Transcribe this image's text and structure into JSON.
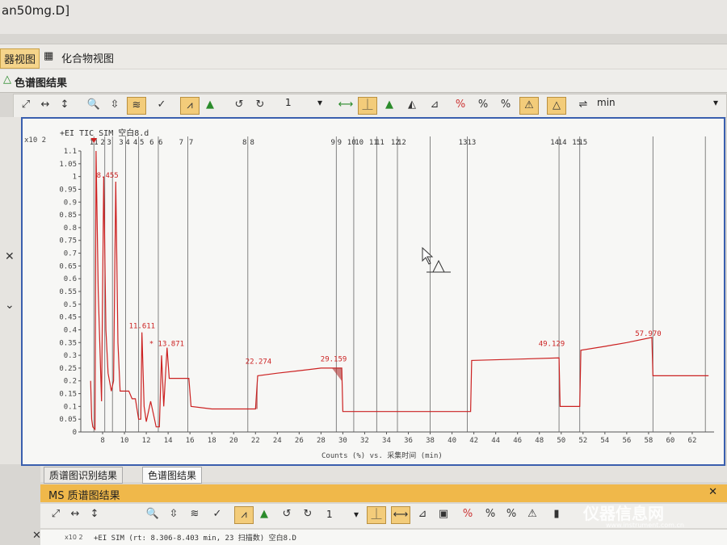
{
  "window": {
    "title": "an50mg.D]"
  },
  "view_tabs": {
    "spectrum_view": "器视图",
    "compound_view": "化合物视图"
  },
  "panel": {
    "title": "色谱图结果"
  },
  "toolbar": {
    "combo_value": "1",
    "unit_combo": "min"
  },
  "chart_data": {
    "type": "line",
    "title": "+EI TIC SIM 空白8.d",
    "y_multiplier": "x10 2",
    "xlabel": "Counts (%) vs. 采集时间 (min)",
    "xlim": [
      6,
      64
    ],
    "ylim": [
      0,
      1.1
    ],
    "xticks": [
      "8",
      "10",
      "12",
      "14",
      "16",
      "18",
      "20",
      "22",
      "24",
      "26",
      "28",
      "30",
      "32",
      "34",
      "36",
      "38",
      "40",
      "42",
      "44",
      "46",
      "48",
      "50",
      "52",
      "54",
      "56",
      "58",
      "60",
      "62"
    ],
    "yticks": [
      "0",
      "0.05",
      "0.1",
      "0.15",
      "0.2",
      "0.25",
      "0.3",
      "0.35",
      "0.4",
      "0.45",
      "0.5",
      "0.55",
      "0.6",
      "0.65",
      "0.7",
      "0.75",
      "0.8",
      "0.85",
      "0.9",
      "0.95",
      "1",
      "1.05",
      "1.1"
    ],
    "segment_labels": [
      "1",
      "1",
      "2",
      "3",
      "3",
      "4",
      "4",
      "5",
      "6",
      "6",
      "7",
      "7",
      "8",
      "8",
      "9",
      "9",
      "10",
      "10",
      "11",
      "11",
      "12",
      "12",
      "13",
      "13",
      "14",
      "14",
      "15",
      "15"
    ],
    "segment_bounds": [
      7.2,
      8.2,
      8.9,
      10.1,
      11.3,
      13.1,
      15.8,
      21.3,
      29.4,
      31.0,
      33.1,
      35.0,
      38.0,
      41.4,
      49.8,
      51.7,
      58.4,
      63.2
    ],
    "peak_labels": [
      {
        "x": 8.455,
        "y": 0.99,
        "text": "8.455"
      },
      {
        "x": 11.611,
        "y": 0.4,
        "text": "11.611"
      },
      {
        "x": 13.871,
        "y": 0.33,
        "text": "* 13.871"
      },
      {
        "x": 22.274,
        "y": 0.26,
        "text": "22.274"
      },
      {
        "x": 29.159,
        "y": 0.27,
        "text": "29.159"
      },
      {
        "x": 49.129,
        "y": 0.33,
        "text": "49.129"
      },
      {
        "x": 57.97,
        "y": 0.37,
        "text": "57.970"
      }
    ],
    "series": [
      {
        "color": "#cc2222",
        "points": [
          [
            6.9,
            0.2
          ],
          [
            7.0,
            0.05
          ],
          [
            7.1,
            0.02
          ],
          [
            7.3,
            0.01
          ],
          [
            7.4,
            1.1
          ],
          [
            7.6,
            0.55
          ],
          [
            7.9,
            0.12
          ],
          [
            8.1,
            1.0
          ],
          [
            8.3,
            0.4
          ],
          [
            8.5,
            0.23
          ],
          [
            8.8,
            0.16
          ],
          [
            9.0,
            0.2
          ],
          [
            9.2,
            0.98
          ],
          [
            9.4,
            0.35
          ],
          [
            9.6,
            0.16
          ],
          [
            10.4,
            0.16
          ],
          [
            10.7,
            0.13
          ],
          [
            11.0,
            0.13
          ],
          [
            11.3,
            0.05
          ],
          [
            11.5,
            0.05
          ],
          [
            11.6,
            0.39
          ],
          [
            11.8,
            0.1
          ],
          [
            12.0,
            0.04
          ],
          [
            12.4,
            0.12
          ],
          [
            12.7,
            0.06
          ],
          [
            12.9,
            0.02
          ],
          [
            13.2,
            0.02
          ],
          [
            13.4,
            0.3
          ],
          [
            13.6,
            0.1
          ],
          [
            13.9,
            0.33
          ],
          [
            14.1,
            0.21
          ],
          [
            15.0,
            0.21
          ],
          [
            15.9,
            0.21
          ],
          [
            16.1,
            0.1
          ],
          [
            18.0,
            0.09
          ],
          [
            22.0,
            0.09
          ],
          [
            22.2,
            0.22
          ],
          [
            24.0,
            0.23
          ],
          [
            26.0,
            0.24
          ],
          [
            28.0,
            0.25
          ],
          [
            29.9,
            0.25
          ],
          [
            30.0,
            0.08
          ],
          [
            35.0,
            0.08
          ],
          [
            41.7,
            0.08
          ],
          [
            41.8,
            0.28
          ],
          [
            46.0,
            0.285
          ],
          [
            49.8,
            0.29
          ],
          [
            49.9,
            0.1
          ],
          [
            51.7,
            0.1
          ],
          [
            51.8,
            0.32
          ],
          [
            54.0,
            0.335
          ],
          [
            56.0,
            0.35
          ],
          [
            58.3,
            0.37
          ],
          [
            58.4,
            0.22
          ],
          [
            63.5,
            0.22
          ]
        ]
      }
    ]
  },
  "bottom_tabs": {
    "tab1": "质谱图识别结果",
    "tab2": "色谱图结果"
  },
  "ms_panel": {
    "title": "MS 质谱图结果",
    "combo_value": "1",
    "y_multiplier": "x10 2",
    "scan_info": "+EI SIM (rt: 8.306-8.403 min, 23 扫描数) 空白8.D"
  },
  "watermark": {
    "brand": "仪器信息网",
    "url": "www.instrument.com.cn"
  }
}
